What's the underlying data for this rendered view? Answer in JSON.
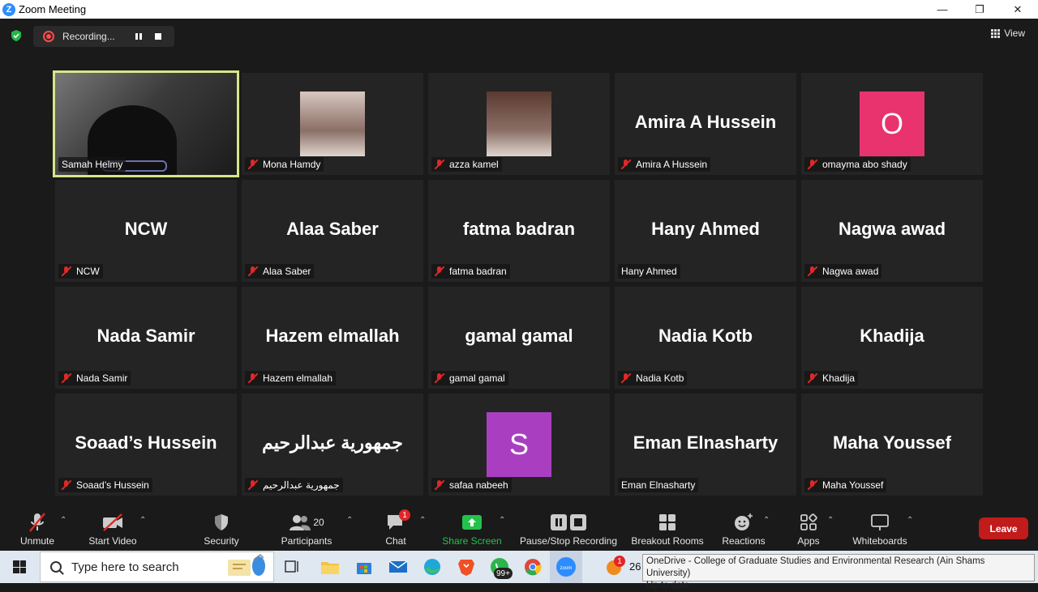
{
  "window": {
    "title": "Zoom Meeting"
  },
  "topbar": {
    "recording_label": "Recording...",
    "view_label": "View"
  },
  "tiles": [
    {
      "name": "Samah Helmy",
      "big": "",
      "muted": false,
      "kind": "camera",
      "active": true
    },
    {
      "name": "Mona Hamdy",
      "big": "",
      "muted": true,
      "kind": "photo",
      "photo_color": "#d8c8c0"
    },
    {
      "name": "azza kamel",
      "big": "",
      "muted": true,
      "kind": "photo",
      "photo_color": "#5a3a30"
    },
    {
      "name": "Amira A Hussein",
      "big": "Amira A Hussein",
      "muted": true,
      "kind": "text"
    },
    {
      "name": "omayma abo shady",
      "big": "",
      "muted": true,
      "kind": "avatar",
      "initial": "O",
      "avatar_color": "#e8336f"
    },
    {
      "name": "NCW",
      "big": "NCW",
      "muted": true,
      "kind": "text"
    },
    {
      "name": "Alaa Saber",
      "big": "Alaa Saber",
      "muted": true,
      "kind": "text"
    },
    {
      "name": "fatma badran",
      "big": "fatma badran",
      "muted": true,
      "kind": "text"
    },
    {
      "name": "Hany Ahmed",
      "big": "Hany Ahmed",
      "muted": false,
      "kind": "text"
    },
    {
      "name": "Nagwa awad",
      "big": "Nagwa awad",
      "muted": true,
      "kind": "text"
    },
    {
      "name": "Nada Samir",
      "big": "Nada Samir",
      "muted": true,
      "kind": "text"
    },
    {
      "name": "Hazem elmallah",
      "big": "Hazem elmallah",
      "muted": true,
      "kind": "text"
    },
    {
      "name": "gamal gamal",
      "big": "gamal gamal",
      "muted": true,
      "kind": "text"
    },
    {
      "name": "Nadia Kotb",
      "big": "Nadia Kotb",
      "muted": true,
      "kind": "text"
    },
    {
      "name": "Khadija",
      "big": "Khadija",
      "muted": true,
      "kind": "text"
    },
    {
      "name": "Soaad’s Hussein",
      "big": "Soaad’s Hussein",
      "muted": true,
      "kind": "text"
    },
    {
      "name": "جمهورية عبدالرحيم",
      "big": "جمهورية عبدالرحيم",
      "muted": true,
      "kind": "text"
    },
    {
      "name": "safaa nabeeh",
      "big": "",
      "muted": true,
      "kind": "avatar",
      "initial": "S",
      "avatar_color": "#a93fc0"
    },
    {
      "name": "Eman Elnasharty",
      "big": "Eman Elnasharty",
      "muted": false,
      "kind": "text"
    },
    {
      "name": "Maha Youssef",
      "big": "Maha Youssef",
      "muted": true,
      "kind": "text"
    }
  ],
  "toolbar": {
    "unmute": "Unmute",
    "start_video": "Start Video",
    "security": "Security",
    "participants": "Participants",
    "participants_count": "20",
    "chat": "Chat",
    "chat_badge": "1",
    "share_screen": "Share Screen",
    "pause_stop_recording": "Pause/Stop Recording",
    "breakout_rooms": "Breakout Rooms",
    "reactions": "Reactions",
    "apps": "Apps",
    "whiteboards": "Whiteboards",
    "leave": "Leave"
  },
  "taskbar": {
    "search_placeholder": "Type here to search",
    "whatsapp_badge": "99+",
    "notify_count": "1",
    "clock_partial": "26"
  },
  "tooltip": {
    "line1": "OneDrive - College of Graduate Studies and Environmental Research (Ain Shams University)",
    "line2": "Up to date"
  },
  "colors": {
    "accent_blue": "#2D8CFF",
    "share_green": "#24c24b",
    "leave_red": "#c11b1b",
    "active_outline": "#d7e58a"
  }
}
